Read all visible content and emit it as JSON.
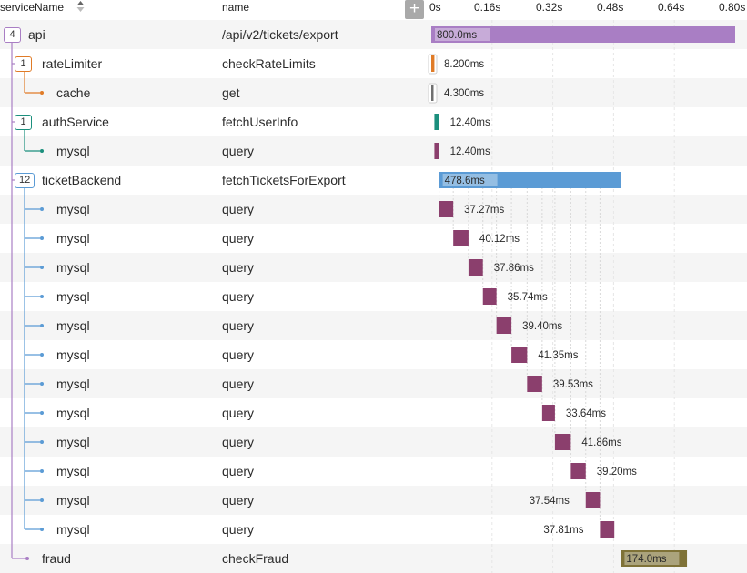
{
  "header": {
    "service_col": "serviceName",
    "name_col": "name",
    "add_button": "+",
    "ticks": [
      "0s",
      "0.16s",
      "0.32s",
      "0.48s",
      "0.64s",
      "0.80s"
    ]
  },
  "rows": [
    {
      "service": "api",
      "name": "/api/v2/tickets/export",
      "badge": "4",
      "depth": 0,
      "parent": null,
      "color": "#a97ec4",
      "start_ms": 0,
      "duration_ms": 800.0,
      "label": "800.0ms",
      "label_inside": true
    },
    {
      "service": "rateLimiter",
      "name": "checkRateLimits",
      "badge": "1",
      "depth": 1,
      "parent": 0,
      "color": "#e07b27",
      "start_ms": 0,
      "duration_ms": 8.2,
      "label": "8.200ms",
      "label_inside": false,
      "boxed": true
    },
    {
      "service": "cache",
      "name": "get",
      "badge": null,
      "depth": 2,
      "parent": 1,
      "color": "#707070",
      "start_ms": 0,
      "duration_ms": 4.3,
      "label": "4.300ms",
      "label_inside": false,
      "boxed": true
    },
    {
      "service": "authService",
      "name": "fetchUserInfo",
      "badge": "1",
      "depth": 1,
      "parent": 0,
      "color": "#1b8f7d",
      "start_ms": 8.2,
      "duration_ms": 12.4,
      "label": "12.40ms",
      "label_inside": false
    },
    {
      "service": "mysql",
      "name": "query",
      "badge": null,
      "depth": 2,
      "parent": 3,
      "color": "#8b3f6d",
      "start_ms": 8.2,
      "duration_ms": 12.4,
      "label": "12.40ms",
      "label_inside": false
    },
    {
      "service": "ticketBackend",
      "name": "fetchTicketsForExport",
      "badge": "12",
      "depth": 1,
      "parent": 0,
      "color": "#5b9bd5",
      "start_ms": 20.6,
      "duration_ms": 478.6,
      "label": "478.6ms",
      "label_inside": true
    },
    {
      "service": "mysql",
      "name": "query",
      "badge": null,
      "depth": 2,
      "parent": 5,
      "color": "#8b3f6d",
      "start_ms": 20.6,
      "duration_ms": 37.27,
      "label": "37.27ms",
      "label_inside": false
    },
    {
      "service": "mysql",
      "name": "query",
      "badge": null,
      "depth": 2,
      "parent": 5,
      "color": "#8b3f6d",
      "start_ms": 57.9,
      "duration_ms": 40.12,
      "label": "40.12ms",
      "label_inside": false
    },
    {
      "service": "mysql",
      "name": "query",
      "badge": null,
      "depth": 2,
      "parent": 5,
      "color": "#8b3f6d",
      "start_ms": 98.0,
      "duration_ms": 37.86,
      "label": "37.86ms",
      "label_inside": false
    },
    {
      "service": "mysql",
      "name": "query",
      "badge": null,
      "depth": 2,
      "parent": 5,
      "color": "#8b3f6d",
      "start_ms": 135.9,
      "duration_ms": 35.74,
      "label": "35.74ms",
      "label_inside": false
    },
    {
      "service": "mysql",
      "name": "query",
      "badge": null,
      "depth": 2,
      "parent": 5,
      "color": "#8b3f6d",
      "start_ms": 171.6,
      "duration_ms": 39.4,
      "label": "39.40ms",
      "label_inside": false
    },
    {
      "service": "mysql",
      "name": "query",
      "badge": null,
      "depth": 2,
      "parent": 5,
      "color": "#8b3f6d",
      "start_ms": 211.0,
      "duration_ms": 41.35,
      "label": "41.35ms",
      "label_inside": false
    },
    {
      "service": "mysql",
      "name": "query",
      "badge": null,
      "depth": 2,
      "parent": 5,
      "color": "#8b3f6d",
      "start_ms": 252.3,
      "duration_ms": 39.53,
      "label": "39.53ms",
      "label_inside": false
    },
    {
      "service": "mysql",
      "name": "query",
      "badge": null,
      "depth": 2,
      "parent": 5,
      "color": "#8b3f6d",
      "start_ms": 291.9,
      "duration_ms": 33.64,
      "label": "33.64ms",
      "label_inside": false
    },
    {
      "service": "mysql",
      "name": "query",
      "badge": null,
      "depth": 2,
      "parent": 5,
      "color": "#8b3f6d",
      "start_ms": 325.5,
      "duration_ms": 41.86,
      "label": "41.86ms",
      "label_inside": false
    },
    {
      "service": "mysql",
      "name": "query",
      "badge": null,
      "depth": 2,
      "parent": 5,
      "color": "#8b3f6d",
      "start_ms": 367.4,
      "duration_ms": 39.2,
      "label": "39.20ms",
      "label_inside": false
    },
    {
      "service": "mysql",
      "name": "query",
      "badge": null,
      "depth": 2,
      "parent": 5,
      "color": "#8b3f6d",
      "start_ms": 406.6,
      "duration_ms": 37.54,
      "label": "37.54ms",
      "label_inside": false,
      "label_left": true
    },
    {
      "service": "mysql",
      "name": "query",
      "badge": null,
      "depth": 2,
      "parent": 5,
      "color": "#8b3f6d",
      "start_ms": 444.1,
      "duration_ms": 37.81,
      "label": "37.81ms",
      "label_inside": false,
      "label_left": true
    },
    {
      "service": "fraud",
      "name": "checkFraud",
      "badge": null,
      "depth": 1,
      "parent": 0,
      "color": "#7f7237",
      "start_ms": 499.2,
      "duration_ms": 174.0,
      "label": "174.0ms",
      "label_inside": true
    }
  ],
  "timeline": {
    "max_ms": 800
  },
  "colors": {
    "api": "#a97ec4",
    "rateLimiter": "#e07b27",
    "authService": "#1b8f7d",
    "ticketBackend": "#5b9bd5",
    "mysql": "#8b3f6d",
    "fraud": "#7f7237",
    "cache": "#707070"
  }
}
